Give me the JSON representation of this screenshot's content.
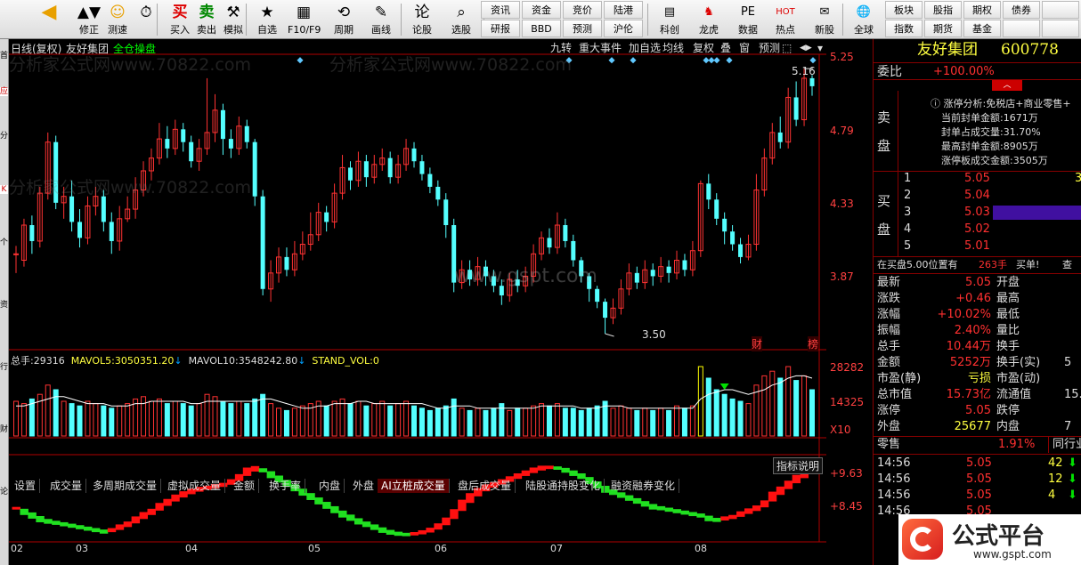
{
  "toolbar": {
    "left_items": [
      {
        "label": "",
        "icon": "◀",
        "name": "back-arrow-icon"
      },
      {
        "label": "修正",
        "icon": "▲▼",
        "name": "up-down-icon"
      },
      {
        "label": "测速",
        "icon": "☺",
        "name": "speed-icon"
      },
      {
        "label": "",
        "icon": "⏱",
        "name": "clock-icon"
      },
      {
        "label": "买入",
        "icon": "买",
        "name": "buy-icon"
      },
      {
        "label": "卖出",
        "icon": "卖",
        "name": "sell-icon"
      },
      {
        "label": "模拟",
        "icon": "⚒",
        "name": "hammer-icon"
      },
      {
        "label": "自选",
        "icon": "★",
        "name": "favorites-icon"
      },
      {
        "label": "F10/F9",
        "icon": "▦",
        "name": "f10-icon"
      },
      {
        "label": "周期",
        "icon": "⟲",
        "name": "period-icon"
      },
      {
        "label": "画线",
        "icon": "✎",
        "name": "pen-icon"
      },
      {
        "label": "论股",
        "icon": "论",
        "name": "discuss-icon"
      },
      {
        "label": "选股",
        "icon": "⌕",
        "name": "pick-icon"
      }
    ],
    "grid1": [
      "资讯",
      "资金",
      "竞价",
      "陆港"
    ],
    "grid2": [
      "研报",
      "BBD",
      "预测",
      "沪伦"
    ],
    "right_items": [
      {
        "label": "科创",
        "icon": "▤",
        "name": "kechuang-icon"
      },
      {
        "label": "龙虎",
        "icon": "♞",
        "name": "longhu-icon"
      },
      {
        "label": "数据",
        "icon": "PE",
        "name": "data-icon"
      },
      {
        "label": "热点",
        "icon": "HOT",
        "name": "hot-icon"
      },
      {
        "label": "新股",
        "icon": "✉",
        "name": "ipo-icon"
      },
      {
        "label": "全球",
        "icon": "🌐",
        "name": "globe-icon"
      }
    ],
    "grid3": [
      "板块",
      "股指",
      "期权",
      "债券",
      ""
    ],
    "grid4": [
      "指数",
      "期货",
      "基金",
      "",
      ""
    ]
  },
  "chart_header": {
    "title": "日线(复权)",
    "stock": "友好集团",
    "mode": "全仓操盘"
  },
  "chart_buttons": [
    "九转",
    "重大事件",
    "加自选",
    "均线",
    "复权",
    "叠",
    "窗",
    "预测"
  ],
  "price_axis": [
    "5.25",
    "4.79",
    "4.33",
    "3.87"
  ],
  "annotations": {
    "high": "5.16",
    "low": "3.50",
    "cai": "财",
    "bang": "榜"
  },
  "volume_header": {
    "total_label": "总手:",
    "total": "29316",
    "ma5_label": "MAVOL5:",
    "ma5": "3050351.20",
    "ma10_label": "MAVOL10:",
    "ma10": "3548242.80",
    "stand_label": "STAND_VOL:",
    "stand": "0"
  },
  "volume_axis": [
    "28282",
    "14325",
    "X10"
  ],
  "tabs": [
    "设置",
    "成交量",
    "多周期成交量",
    "虚拟成交量",
    "金额",
    "换手率",
    "内盘",
    "外盘",
    "AI立桩成交量",
    "盘后成交量",
    "陆股通持股变化",
    "融资融券变化"
  ],
  "active_tab": "AI立桩成交量",
  "indicator": {
    "button": "指标说明",
    "axis": [
      "+9.63",
      "+8.45"
    ]
  },
  "months": [
    "02",
    "03",
    "04",
    "05",
    "06",
    "07",
    "08"
  ],
  "watermark_lines": [
    "分析家公式网www.70822.com",
    "分析家公式网www.70822.com",
    "分析家公式网www.70822.com"
  ],
  "center_watermark": "www.gspt.com",
  "right": {
    "title": "友好集团",
    "code": "600778",
    "weibi_label": "委比",
    "weibi": "+100.00%",
    "sell_label": "卖盘",
    "buy_label": "买盘",
    "limit_title": "涨停分析:免税店+商业零售+",
    "limit_rows": [
      "当前封单金额:1671万",
      "封单占成交量:31.70%",
      "最高封单金额:8905万",
      "涨停板成交金额:3505万"
    ],
    "bids": [
      {
        "n": "1",
        "p": "5.05",
        "v": "3"
      },
      {
        "n": "2",
        "p": "5.04",
        "v": ""
      },
      {
        "n": "3",
        "p": "5.03",
        "v": ""
      },
      {
        "n": "4",
        "p": "5.02",
        "v": ""
      },
      {
        "n": "5",
        "p": "5.01",
        "v": ""
      }
    ],
    "position_text": "在买盘5.00位置有",
    "position_vol": "263手",
    "position_act": "买单!",
    "position_q": "查",
    "stats": [
      {
        "l": "最新",
        "v": "5.05",
        "l2": "开盘",
        "v2": ""
      },
      {
        "l": "涨跌",
        "v": "+0.46",
        "l2": "最高",
        "v2": ""
      },
      {
        "l": "涨幅",
        "v": "+10.02%",
        "l2": "最低",
        "v2": ""
      },
      {
        "l": "振幅",
        "v": "2.40%",
        "l2": "量比",
        "v2": ""
      },
      {
        "l": "总手",
        "v": "10.44万",
        "l2": "换手",
        "v2": ""
      },
      {
        "l": "金额",
        "v": "5252万",
        "l2": "换手(实)",
        "v2": "5"
      },
      {
        "l": "市盈(静)",
        "v": "亏损",
        "l2": "市盈(动)",
        "v2": ""
      },
      {
        "l": "总市值",
        "v": "15.73亿",
        "l2": "流通值",
        "v2": "15."
      },
      {
        "l": "涨停",
        "v": "5.05",
        "l2": "跌停",
        "v2": ""
      },
      {
        "l": "外盘",
        "v": "25677",
        "l2": "内盘",
        "v2": "7"
      }
    ],
    "retail_label": "零售",
    "retail_pct": "1.91%",
    "industry_label": "同行业",
    "ticks": [
      {
        "t": "14:56",
        "p": "5.05",
        "v": "42"
      },
      {
        "t": "14:56",
        "p": "5.05",
        "v": "12"
      },
      {
        "t": "14:56",
        "p": "5.05",
        "v": "4"
      },
      {
        "t": "14:56",
        "p": "5.05",
        "v": ""
      }
    ],
    "logo_text": "公式平台",
    "logo_url": "www.gspt.com"
  },
  "colors": {
    "up": "#ff3232",
    "down": "#54ffff",
    "bg": "#000000",
    "axis": "#b00000",
    "yellow": "#ffff00"
  },
  "chart_data": {
    "type": "candlestick",
    "ylim": [
      3.45,
      5.25
    ],
    "x": [
      "02",
      "03",
      "04",
      "05",
      "06",
      "07",
      "08"
    ],
    "candles": [
      [
        4.0,
        4.0,
        4.05,
        3.88
      ],
      [
        3.96,
        4.18,
        4.22,
        3.92
      ],
      [
        4.18,
        4.08,
        4.24,
        4.0
      ],
      [
        4.08,
        4.38,
        4.42,
        4.04
      ],
      [
        4.38,
        4.7,
        4.76,
        4.34
      ],
      [
        4.7,
        4.32,
        4.74,
        4.28
      ],
      [
        4.32,
        4.36,
        4.42,
        4.22
      ],
      [
        4.36,
        4.2,
        4.46,
        4.14
      ],
      [
        4.2,
        4.1,
        4.28,
        4.04
      ],
      [
        4.1,
        4.3,
        4.36,
        4.06
      ],
      [
        4.3,
        4.36,
        4.42,
        4.24
      ],
      [
        4.36,
        4.2,
        4.4,
        4.14
      ],
      [
        4.2,
        4.08,
        4.26,
        4.0
      ],
      [
        4.08,
        4.22,
        4.3,
        4.02
      ],
      [
        4.22,
        4.28,
        4.36,
        4.2
      ],
      [
        4.28,
        4.4,
        4.48,
        4.22
      ],
      [
        4.4,
        4.52,
        4.58,
        4.36
      ],
      [
        4.52,
        4.6,
        4.66,
        4.46
      ],
      [
        4.6,
        4.72,
        4.82,
        4.56
      ],
      [
        4.72,
        4.66,
        4.8,
        4.6
      ],
      [
        4.66,
        4.78,
        4.84,
        4.62
      ],
      [
        4.78,
        4.7,
        4.82,
        4.64
      ],
      [
        4.7,
        4.58,
        4.74,
        4.54
      ],
      [
        4.58,
        4.66,
        4.72,
        4.52
      ],
      [
        4.66,
        4.76,
        5.1,
        4.62
      ],
      [
        4.76,
        4.9,
        5.0,
        4.7
      ],
      [
        4.9,
        4.72,
        4.94,
        4.62
      ],
      [
        4.72,
        4.66,
        4.78,
        4.6
      ],
      [
        4.66,
        4.8,
        4.86,
        4.62
      ],
      [
        4.8,
        4.7,
        4.84,
        4.66
      ],
      [
        4.7,
        4.36,
        4.72,
        4.3
      ],
      [
        4.36,
        3.78,
        4.4,
        3.74
      ],
      [
        3.78,
        3.88,
        3.96,
        3.7
      ],
      [
        3.88,
        3.98,
        4.04,
        3.82
      ],
      [
        3.98,
        3.9,
        4.04,
        3.86
      ],
      [
        3.9,
        4.0,
        4.08,
        3.86
      ],
      [
        4.0,
        4.06,
        4.14,
        3.96
      ],
      [
        4.06,
        4.12,
        4.26,
        4.02
      ],
      [
        4.12,
        4.26,
        4.32,
        4.08
      ],
      [
        4.26,
        4.2,
        4.3,
        4.14
      ],
      [
        4.2,
        4.38,
        4.44,
        4.16
      ],
      [
        4.38,
        4.54,
        4.62,
        4.34
      ],
      [
        4.54,
        4.46,
        4.58,
        4.4
      ],
      [
        4.46,
        4.58,
        4.64,
        4.42
      ],
      [
        4.58,
        4.48,
        4.62,
        4.42
      ],
      [
        4.48,
        4.56,
        4.62,
        4.44
      ],
      [
        4.56,
        4.6,
        4.66,
        4.52
      ],
      [
        4.6,
        4.48,
        4.64,
        4.44
      ],
      [
        4.48,
        4.56,
        4.62,
        4.44
      ],
      [
        4.56,
        4.66,
        4.72,
        4.52
      ],
      [
        4.66,
        4.58,
        4.7,
        4.54
      ],
      [
        4.58,
        4.5,
        4.62,
        4.46
      ],
      [
        4.5,
        4.42,
        4.54,
        4.38
      ],
      [
        4.42,
        4.34,
        4.46,
        4.3
      ],
      [
        4.34,
        4.18,
        4.38,
        4.1
      ],
      [
        4.18,
        3.82,
        4.22,
        3.76
      ],
      [
        3.82,
        3.9,
        3.96,
        3.78
      ],
      [
        3.9,
        3.84,
        3.96,
        3.8
      ],
      [
        3.84,
        3.92,
        3.98,
        3.8
      ],
      [
        3.92,
        3.86,
        3.96,
        3.8
      ],
      [
        3.86,
        3.8,
        3.9,
        3.76
      ],
      [
        3.8,
        3.74,
        3.84,
        3.68
      ],
      [
        3.74,
        3.84,
        3.88,
        3.7
      ],
      [
        3.84,
        3.8,
        3.9,
        3.76
      ],
      [
        3.8,
        3.86,
        3.92,
        3.76
      ],
      [
        3.86,
        4.0,
        4.06,
        3.82
      ],
      [
        4.0,
        4.1,
        4.14,
        3.96
      ],
      [
        4.1,
        4.04,
        4.16,
        4.0
      ],
      [
        4.04,
        4.18,
        4.26,
        4.0
      ],
      [
        4.18,
        4.08,
        4.22,
        4.04
      ],
      [
        4.08,
        3.96,
        4.12,
        3.92
      ],
      [
        3.96,
        3.86,
        3.98,
        3.82
      ],
      [
        3.86,
        3.78,
        3.88,
        3.7
      ],
      [
        3.78,
        3.7,
        3.8,
        3.66
      ],
      [
        3.7,
        3.6,
        3.72,
        3.5
      ],
      [
        3.6,
        3.66,
        3.72,
        3.56
      ],
      [
        3.66,
        3.78,
        3.84,
        3.62
      ],
      [
        3.78,
        3.88,
        3.94,
        3.74
      ],
      [
        3.88,
        3.82,
        3.92,
        3.78
      ],
      [
        3.82,
        3.9,
        3.96,
        3.78
      ],
      [
        3.9,
        3.86,
        3.94,
        3.8
      ],
      [
        3.86,
        3.92,
        3.98,
        3.82
      ],
      [
        3.92,
        3.88,
        3.96,
        3.82
      ],
      [
        3.88,
        3.96,
        4.02,
        3.84
      ],
      [
        3.96,
        3.9,
        4.0,
        3.86
      ],
      [
        3.9,
        4.02,
        4.08,
        3.86
      ],
      [
        4.02,
        4.44,
        4.46,
        3.98
      ],
      [
        4.44,
        4.34,
        4.5,
        4.28
      ],
      [
        4.34,
        4.22,
        4.38,
        4.18
      ],
      [
        4.22,
        4.14,
        4.26,
        4.06
      ],
      [
        4.14,
        4.06,
        4.18,
        4.02
      ],
      [
        4.06,
        3.98,
        4.1,
        3.94
      ],
      [
        3.98,
        4.06,
        4.12,
        3.96
      ],
      [
        4.06,
        4.4,
        4.5,
        4.02
      ],
      [
        4.4,
        4.6,
        4.66,
        4.36
      ],
      [
        4.6,
        4.76,
        4.82,
        4.56
      ],
      [
        4.76,
        4.7,
        4.86,
        4.66
      ],
      [
        4.7,
        4.98,
        5.04,
        4.66
      ],
      [
        4.98,
        4.84,
        5.08,
        4.8
      ],
      [
        4.84,
        5.1,
        5.16,
        4.8
      ],
      [
        5.1,
        5.05,
        5.12,
        4.99
      ]
    ],
    "volume": [
      15,
      14,
      16,
      18,
      22,
      20,
      15,
      14,
      13,
      15,
      14,
      13,
      12,
      13,
      14,
      16,
      17,
      15,
      16,
      14,
      15,
      14,
      13,
      14,
      18,
      17,
      15,
      14,
      15,
      14,
      16,
      18,
      14,
      12,
      11,
      12,
      13,
      14,
      15,
      13,
      15,
      16,
      14,
      15,
      13,
      14,
      15,
      13,
      14,
      15,
      13,
      12,
      11,
      12,
      13,
      16,
      12,
      11,
      12,
      11,
      12,
      14,
      11,
      12,
      12,
      13,
      14,
      13,
      14,
      12,
      12,
      11,
      12,
      13,
      15,
      12,
      13,
      12,
      11,
      12,
      11,
      12,
      11,
      13,
      12,
      13,
      30,
      25,
      20,
      18,
      16,
      15,
      14,
      22,
      26,
      28,
      25,
      30,
      24,
      26,
      20
    ],
    "mavol": [
      13,
      13,
      14,
      15,
      16,
      17,
      17,
      16,
      15,
      14,
      14,
      14,
      13,
      13,
      13,
      14,
      14,
      15,
      15,
      15,
      15,
      15,
      14,
      14,
      15,
      15,
      15,
      15,
      15,
      15,
      15,
      16,
      16,
      15,
      14,
      13,
      12,
      12,
      13,
      13,
      14,
      14,
      14,
      15,
      15,
      14,
      14,
      14,
      14,
      14,
      14,
      14,
      13,
      12,
      12,
      13,
      13,
      13,
      12,
      12,
      12,
      12,
      12,
      12,
      12,
      12,
      13,
      13,
      13,
      13,
      13,
      12,
      12,
      12,
      13,
      13,
      13,
      12,
      12,
      12,
      12,
      12,
      12,
      12,
      12,
      12,
      16,
      18,
      19,
      20,
      20,
      19,
      18,
      19,
      20,
      22,
      23,
      25,
      26,
      26,
      25
    ],
    "indicator": [
      -2,
      -2.5,
      -3,
      -3.5,
      -3.8,
      -4,
      -4.2,
      -4.4,
      -4.6,
      -4.8,
      -5,
      -5.2,
      -5,
      -4.6,
      -4.2,
      -3.6,
      -3,
      -2.5,
      -1.8,
      -1.2,
      -0.6,
      -0.1,
      0.3,
      0.6,
      0.8,
      1,
      1.2,
      1.6,
      2.2,
      3,
      3.4,
      3.2,
      2.6,
      2,
      1.4,
      0.8,
      0.2,
      -0.4,
      -1,
      -1.6,
      -2.2,
      -2.8,
      -3.3,
      -3.8,
      -4.2,
      -4.6,
      -5,
      -5.3,
      -5.5,
      -5.6,
      -5.5,
      -5.3,
      -5,
      -4.5,
      -3.8,
      -2.8,
      -1.6,
      -0.6,
      0.2,
      0.8,
      1.2,
      1.6,
      2,
      2.4,
      2.8,
      3.2,
      3.5,
      3.6,
      3.5,
      3.2,
      2.8,
      2.4,
      1.8,
      1.2,
      0.6,
      0.2,
      -0.2,
      -0.6,
      -1,
      -1.4,
      -1.8,
      -2,
      -2.2,
      -2.4,
      -2.6,
      -2.8,
      -3,
      -3.4,
      -3.6,
      -3.4,
      -3.2,
      -2.8,
      -2.4,
      -2,
      -1.4,
      -0.4,
      0.4,
      1.2,
      2,
      2.6,
      3.2
    ]
  }
}
